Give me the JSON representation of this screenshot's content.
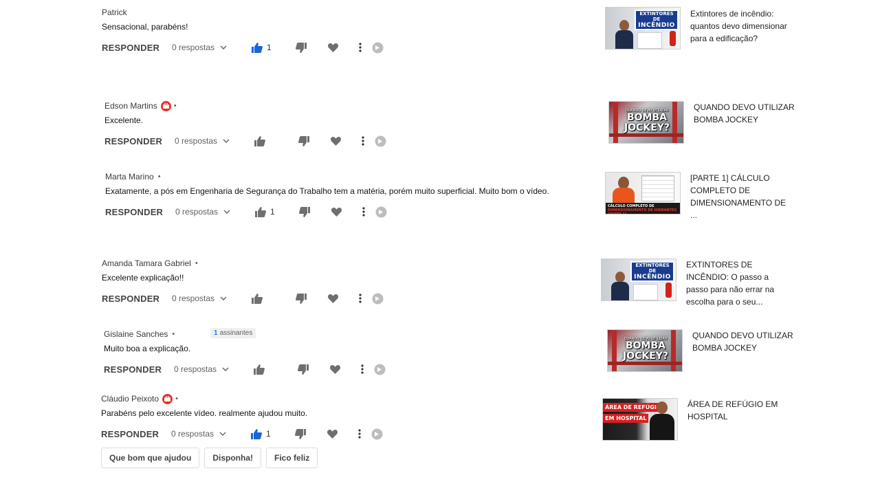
{
  "comments": [
    {
      "author": "Patrick",
      "text": "Sensacional, parabéns!",
      "reply_label": "RESPONDER",
      "replies_label": "0 respostas",
      "likes": "1",
      "liked": true,
      "owner_badge": false,
      "dot": ""
    },
    {
      "author": "Edson Martins",
      "text": "Excelente.",
      "reply_label": "RESPONDER",
      "replies_label": "0 respostas",
      "likes": "",
      "liked": false,
      "owner_badge": true,
      "dot": "•"
    },
    {
      "author": "Marta Marino",
      "text": "Exatamente, a pós em Engenharia de Segurança do Trabalho tem a matéria, porém muito superficial. Muito bom o vídeo.",
      "reply_label": "RESPONDER",
      "replies_label": "0 respostas",
      "likes": "1",
      "liked": false,
      "owner_badge": false,
      "dot": "•"
    },
    {
      "author": "Amanda Tamara Gabriel",
      "text": "Excelente explicação!!",
      "reply_label": "RESPONDER",
      "replies_label": "0 respostas",
      "likes": "",
      "liked": false,
      "owner_badge": false,
      "dot": "•"
    },
    {
      "author": "Gislaine Sanches",
      "text": "Muito boa a explicação.",
      "reply_label": "RESPONDER",
      "replies_label": "0 respostas",
      "likes": "",
      "liked": false,
      "owner_badge": false,
      "dot": "•",
      "sub_badge_count": "1",
      "sub_badge_label": "assinantes"
    },
    {
      "author": "Cláudio Peixoto",
      "text": "Parabéns pelo excelente vídeo. realmente ajudou muito.",
      "reply_label": "RESPONDER",
      "replies_label": "0 respostas",
      "likes": "1",
      "liked": true,
      "owner_badge": true,
      "dot": "•"
    }
  ],
  "quick_replies": [
    "Que bom que ajudou",
    "Disponha!",
    "Fico feliz"
  ],
  "videos": [
    {
      "title": "Extintores de incêndio: quantos devo dimensionar para a edificação?",
      "thumb_lines": [
        "EXTINTORES DE",
        "INCÊNDIO",
        "como dimensionar?"
      ]
    },
    {
      "title": "QUANDO DEVO UTILIZAR BOMBA JOCKEY",
      "thumb_small": "QUANDO DEVO UTILIZAR",
      "thumb_text": "BOMBA JOCKEY?"
    },
    {
      "title": "[PARTE 1] CÁLCULO COMPLETO DE DIMENSIONAMENTO DE ...",
      "thumb_text": "CÁLCULO COMPLETO DE",
      "thumb_text_red": "DIMENSIONAMENTO DE HIDRANTES [PARTE 1]"
    },
    {
      "title": "EXTINTORES DE INCÊNDIO: O passo a passo para não errar na escolha para o seu...",
      "thumb_lines": [
        "EXTINTORES DE",
        "INCÊNDIO",
        "como escolher?"
      ]
    },
    {
      "title": "QUANDO DEVO UTILIZAR BOMBA JOCKEY",
      "thumb_small": "QUANDO DEVO UTILIZAR",
      "thumb_text": "BOMBA JOCKEY?"
    },
    {
      "title": "ÁREA DE REFÚGIO EM HOSPITAL",
      "thumb_lines": [
        "ÁREA DE REFÚGIO",
        "EM HOSPITAL"
      ]
    }
  ],
  "colors": {
    "like_active": "#1a64d6",
    "icon_gray": "#6f6f6f",
    "owner_badge": "#e8302a"
  }
}
